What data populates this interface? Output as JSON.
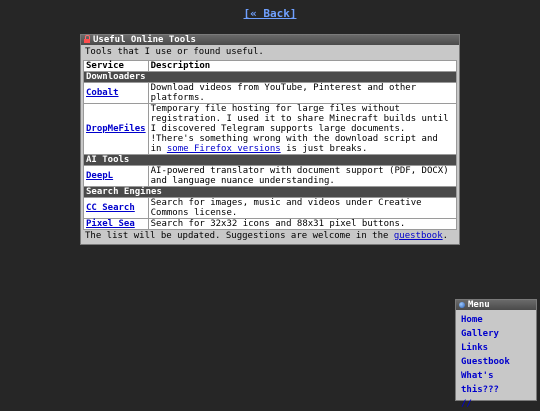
{
  "back_link": "[« Back]",
  "panel": {
    "title": "Useful Online Tools",
    "intro": "Tools that I use or found useful.",
    "col_service": "Service",
    "col_description": "Description",
    "sections": {
      "downloaders": "Downloaders",
      "ai": "AI Tools",
      "search": "Search Engines"
    },
    "rows": {
      "cobalt": {
        "name": "Cobalt",
        "desc": "Download videos from YouTube, Pinterest and other platforms."
      },
      "dropmefiles": {
        "name": "DropMeFiles",
        "desc": "Temporary file hosting for large files without registration. I used it to share Minecraft builds until I discovered Telegram supports large documents.",
        "warn_pre": "!There's something wrong with the download script and in ",
        "warn_link": "some Firefox versions",
        "warn_post": " is just breaks."
      },
      "deepl": {
        "name": "DeepL",
        "desc": "AI-powered translator with document support (PDF, DOCX) and language nuance understanding."
      },
      "ccsearch": {
        "name": "CC Search",
        "desc": "Search for images, music and videos under Creative Commons license."
      },
      "pixelsea": {
        "name": "Pixel Sea",
        "desc": "Search for 32x32 icons and 88x31 pixel buttons."
      }
    },
    "footer_pre": "The list will be updated. Suggestions are welcome in the ",
    "footer_link": "guestbook",
    "footer_post": "."
  },
  "menu": {
    "title": "Menu",
    "items": [
      "Home",
      "Gallery",
      "Links",
      "Guestbook",
      "What's this???",
      "//"
    ]
  },
  "icons": {
    "panel": "lock-icon",
    "menu": "globe-icon"
  }
}
